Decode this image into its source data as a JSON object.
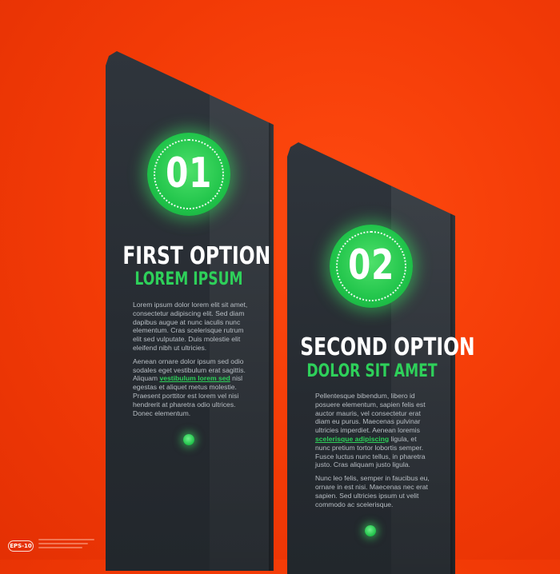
{
  "options": [
    {
      "number": "01",
      "title": "FIRST OPTION",
      "subtitle": "LOREM IPSUM",
      "paragraph1": "Lorem ipsum dolor lorem elit sit amet, consectetur adipiscing elit. Sed diam dapibus augue at nunc iaculis nunc elementum. Cras scelerisque rutrum elit sed vulputate. Duis molestie elit eleifend nibh ut ultricies.",
      "paragraph2_before": "Aenean ornare dolor ipsum sed odio sodales eget vestibulum erat sagittis. Aliquam ",
      "paragraph2_link": "vestibulum lorem sed",
      "paragraph2_after": " nisl egestas et aliquet metus molestie. Praesent porttitor est lorem vel nisi hendrerit at pharetra odio ultrices. Donec elementum."
    },
    {
      "number": "02",
      "title": "SECOND OPTION",
      "subtitle": "DOLOR SIT AMET",
      "paragraph1_before": "Pellentesque bibendum, libero id posuere elementum, sapien felis est auctor mauris, vel consectetur erat diam eu purus. Maecenas pulvinar ultricies imperdiet. Aenean loremis ",
      "paragraph1_link": "scelerisque adipiscing",
      "paragraph1_after": " ligula, et nunc pretium tortor lobortis semper. Fusce luctus nunc tellus, in pharetra justo. Cras aliquam justo ligula.",
      "paragraph2": "Nunc leo felis, semper in faucibus eu, ornare in est nisi. Maecenas nec erat sapien. Sed ultricies ipsum ut velit commodo ac scelerisque."
    }
  ],
  "footer": {
    "badge": "EPS-10"
  },
  "colors": {
    "background": "#f23a06",
    "panel": "#2a2f35",
    "accent": "#2ed05a",
    "title": "#ffffff"
  }
}
